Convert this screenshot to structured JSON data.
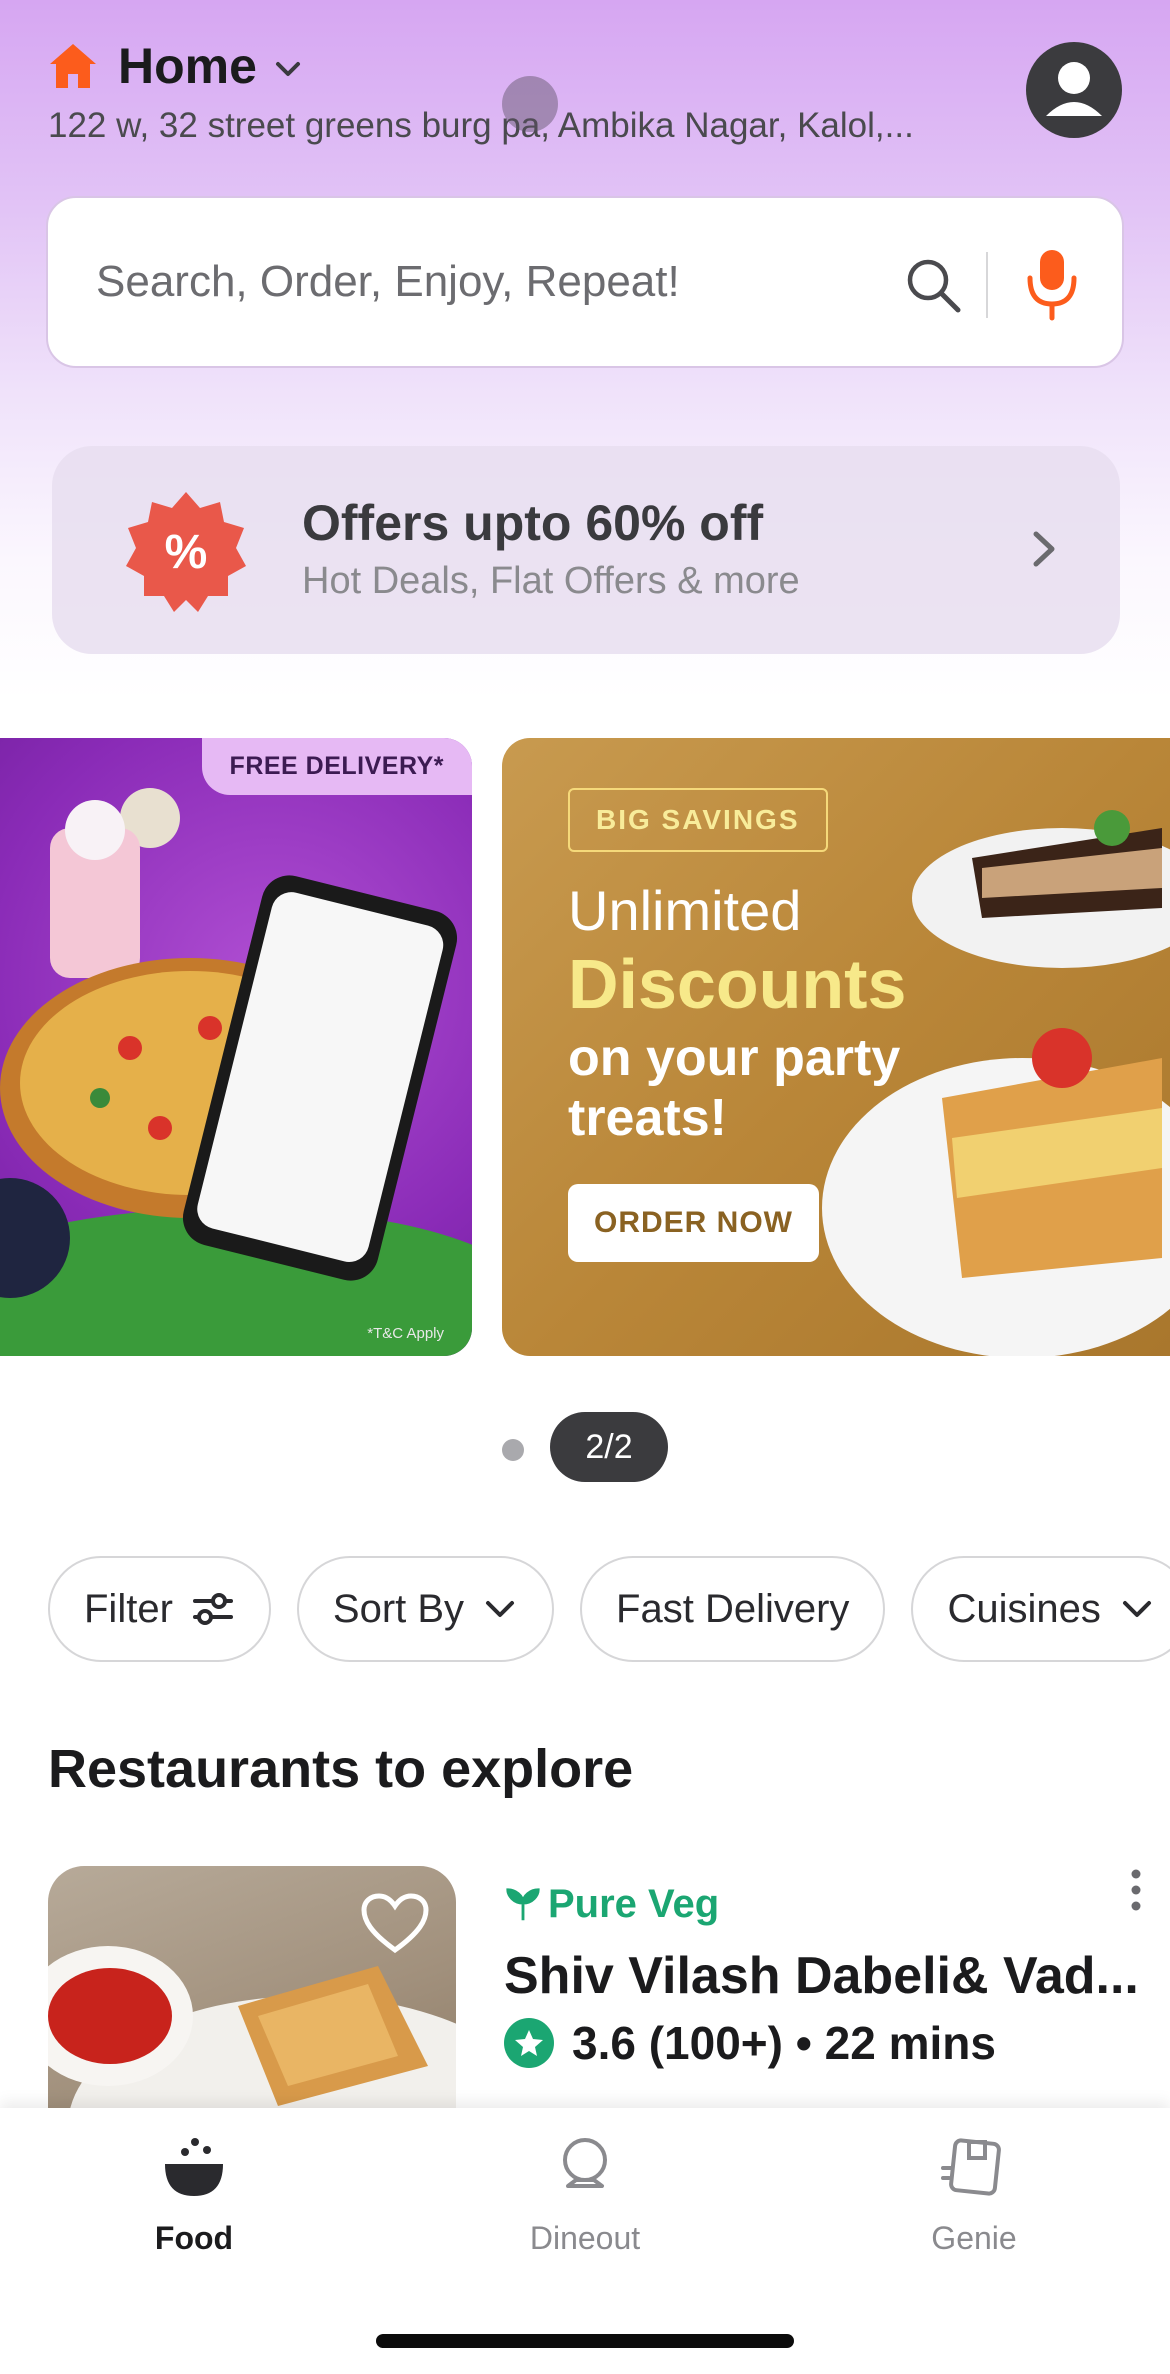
{
  "header": {
    "location_label": "Home",
    "address": "122 w, 32 street greens burg pa, Ambika Nagar, Kalol,..."
  },
  "search": {
    "placeholder": "Search, Order, Enjoy, Repeat!"
  },
  "offers": {
    "title": "Offers upto 60% off",
    "subtitle": "Hot Deals, Flat Offers & more",
    "badge_symbol": "%"
  },
  "banners": {
    "left": {
      "tag": "FREE DELIVERY*",
      "note": "*T&C Apply"
    },
    "right": {
      "tag": "BIG SAVINGS",
      "line1": "Unlimited",
      "line2": "Discounts",
      "line3": "on your party treats!",
      "cta": "ORDER NOW"
    }
  },
  "pager": {
    "indicator": "2/2"
  },
  "filters": [
    {
      "label": "Filter",
      "icon": "sliders-icon"
    },
    {
      "label": "Sort By",
      "icon": "chevron-down-icon"
    },
    {
      "label": "Fast Delivery"
    },
    {
      "label": "Cuisines",
      "icon": "chevron-down-icon"
    }
  ],
  "section": {
    "title": "Restaurants to explore"
  },
  "restaurant": {
    "tag": "Pure Veg",
    "name": "Shiv Vilash Dabeli& Vad...",
    "rating": "3.6 (100+) • 22 mins"
  },
  "bottom_nav": [
    {
      "label": "Food",
      "icon": "food-bowl-icon",
      "active": true
    },
    {
      "label": "Dineout",
      "icon": "dineout-icon",
      "active": false
    },
    {
      "label": "Genie",
      "icon": "genie-icon",
      "active": false
    }
  ],
  "colors": {
    "accent_orange": "#fc5c1c",
    "pure_veg_green": "#1ba672",
    "header_purple": "#d6a6f2"
  }
}
